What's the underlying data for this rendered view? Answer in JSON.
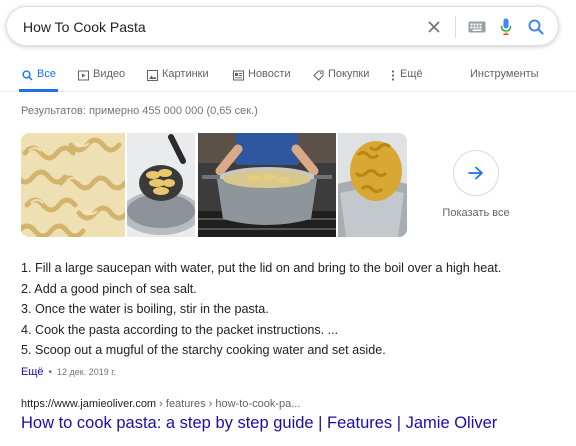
{
  "search": {
    "query": "How To Cook Pasta",
    "icons": {
      "clear": "close-icon",
      "keyboard": "keyboard-icon",
      "mic": "microphone-icon",
      "search": "search-icon"
    },
    "colors": {
      "mic_blue": "#4285f4",
      "mic_red": "#ea4335",
      "search_blue": "#4285f4"
    }
  },
  "tabs": [
    {
      "label": "Все",
      "icon": "search-icon",
      "active": true
    },
    {
      "label": "Видео",
      "icon": "video-icon"
    },
    {
      "label": "Картинки",
      "icon": "image-icon"
    },
    {
      "label": "Новости",
      "icon": "news-icon"
    },
    {
      "label": "Покупки",
      "icon": "tag-icon"
    },
    {
      "label": "Ещё",
      "icon": "more-vert-icon"
    }
  ],
  "tools_label": "Инструменты",
  "result_stats": "Результатов: примерно 455 000 000 (0,65 сек.)",
  "images": {
    "show_all_label": "Показать все",
    "items": [
      "pasta-fusilli-image",
      "pasta-ladle-image",
      "pot-on-stove-image",
      "pasta-strainer-image"
    ]
  },
  "steps": [
    "1. Fill a large saucepan with water, put the lid on and bring to the boil over a high heat.",
    "2. Add a good pinch of sea salt.",
    "3. Once the water is boiling, stir in the pasta.",
    "4. Cook the pasta according to the packet instructions. ...",
    "5. Scoop out a mugful of the starchy cooking water and set aside."
  ],
  "more": {
    "link": "Ещё",
    "dot": "•",
    "date": "12 дек. 2019 г."
  },
  "result": {
    "cite_domain": "https://www.jamieoliver.com",
    "cite_path": " › features › how-to-cook-pa...",
    "title": "How to cook pasta: a step by step guide | Features | Jamie Oliver"
  },
  "colors": {
    "link": "#1a0dab",
    "accent": "#1a73e8",
    "muted": "#70757a"
  }
}
